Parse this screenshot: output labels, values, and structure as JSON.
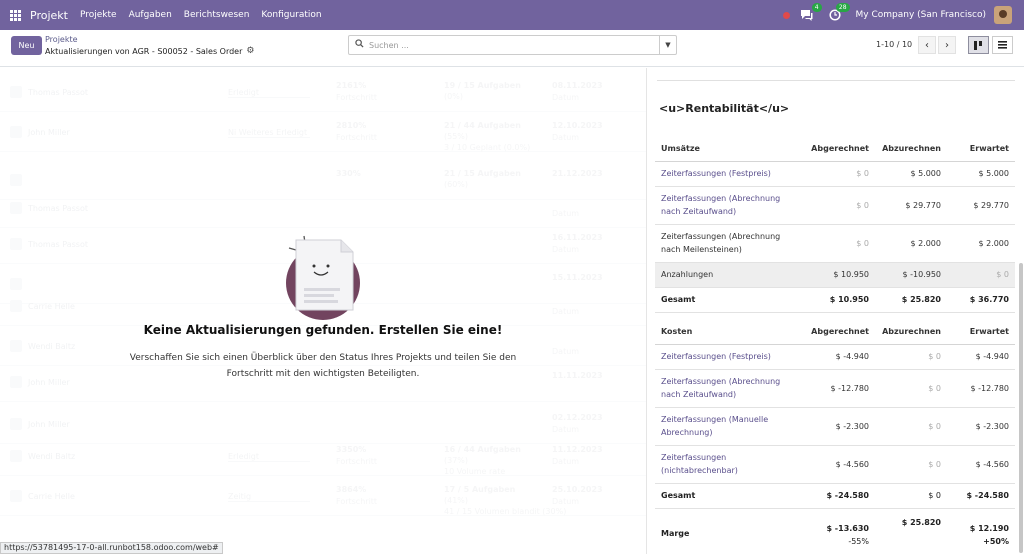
{
  "navbar": {
    "brand": "Projekt",
    "menu": [
      "Projekte",
      "Aufgaben",
      "Berichtswesen",
      "Konfiguration"
    ],
    "messages_count": "4",
    "activities_count": "28",
    "company": "My Company (San Francisco)",
    "colors": {
      "bar": "#71639e"
    }
  },
  "control_panel": {
    "new_label": "Neu",
    "breadcrumb_parent": "Projekte",
    "breadcrumb_current": "Aktualisierungen von AGR - S00052 - Sales Order",
    "search_placeholder": "Suchen ...",
    "pager": "1-10 / 10"
  },
  "background_rows": [
    {
      "name": "Thomas Passot",
      "status": "Erledigt",
      "progress": "2161%",
      "progress_sub": "Fortschritt",
      "tasks": "19 / 15 Aufgaben",
      "tasks_sub": "(0%)",
      "date": "08.11.2023",
      "date_sub": "Datum"
    },
    {
      "name": "John Miller",
      "status": "Ni Weiteres Erledigt",
      "progress": "2810%",
      "progress_sub": "Fortschritt",
      "tasks": "21 / 44 Aufgaben",
      "tasks_sub": "(55%)",
      "tasks_sub2": "3 / 10 Geplant (0.0%)",
      "date": "12.10.2023",
      "date_sub": "Datum"
    },
    {
      "name": "",
      "status": "",
      "progress": "330%",
      "progress_sub": "",
      "tasks": "21 / 15 Aufgaben",
      "tasks_sub": "(60%)",
      "tasks_sub2": "",
      "date": "21.12.2023",
      "date_sub": ""
    },
    {
      "name": "Thomas Passot",
      "status": "",
      "progress": "",
      "progress_sub": "",
      "tasks": "",
      "tasks_sub": "",
      "date": "",
      "date_sub": "Datum"
    },
    {
      "name": "Thomas Passot",
      "status": "",
      "progress": "",
      "progress_sub": "",
      "tasks": "",
      "tasks_sub": "",
      "date": "16.11.2023",
      "date_sub": "Datum"
    },
    {
      "name": "",
      "status": "",
      "progress": "",
      "progress_sub": "",
      "tasks": "",
      "tasks_sub": "",
      "date": "15.11.2023",
      "date_sub": ""
    },
    {
      "name": "Carrie Helle",
      "status": "",
      "progress": "",
      "progress_sub": "",
      "tasks": "",
      "tasks_sub": "",
      "date": "",
      "date_sub": "Datum"
    },
    {
      "name": "Wendi Baltz",
      "status": "",
      "progress": "",
      "progress_sub": "",
      "tasks": "",
      "tasks_sub": "",
      "date": "",
      "date_sub": "Datum"
    },
    {
      "name": "John Miller",
      "status": "",
      "progress": "",
      "progress_sub": "",
      "tasks": "",
      "tasks_sub": "",
      "date": "11.11.2023",
      "date_sub": ""
    },
    {
      "name": "John Miller",
      "status": "",
      "progress": "",
      "progress_sub": "",
      "tasks": "",
      "tasks_sub": "",
      "date": "02.12.2023",
      "date_sub": "Datum"
    },
    {
      "name": "Wendi Baltz",
      "status": "Erledigt",
      "progress": "3350%",
      "progress_sub": "Fortschritt",
      "tasks": "16 / 44 Aufgaben",
      "tasks_sub": "(37%)",
      "tasks_sub2": "10 Volume rate",
      "date": "11.12.2023",
      "date_sub": "Datum"
    },
    {
      "name": "Carrie Helle",
      "status": "Zeitig",
      "progress": "3864%",
      "progress_sub": "Fortschritt",
      "tasks": "17 / 5 Aufgaben",
      "tasks_sub": "(41%)",
      "tasks_sub2": "41 / 15 Volumen blandit (30%)",
      "date": "25.10.2023",
      "date_sub": "Datum"
    }
  ],
  "empty_state": {
    "title": "Keine Aktualisierungen gefunden. Erstellen Sie eine!",
    "text": "Verschaffen Sie sich einen Überblick über den Status Ihres Projekts und teilen Sie den Fortschritt mit den wichtigsten Beteiligten."
  },
  "profitability": {
    "title": "<u>Rentabilität</u>",
    "revenue": {
      "headers": [
        "Umsätze",
        "Abgerechnet",
        "Abzurechnen",
        "Erwartet"
      ],
      "rows": [
        {
          "label": "Zeiterfassungen (Festpreis)",
          "invoiced": "$ 0",
          "to_invoice": "$ 5.000",
          "expected": "$ 5.000"
        },
        {
          "label": "Zeiterfassungen (Abrechnung nach Zeitaufwand)",
          "invoiced": "$ 0",
          "to_invoice": "$ 29.770",
          "expected": "$ 29.770"
        },
        {
          "label": "Zeiterfassungen (Abrechnung nach Meilensteinen)",
          "invoiced": "$ 0",
          "to_invoice": "$ 2.000",
          "expected": "$ 2.000"
        },
        {
          "label": "Anzahlungen",
          "invoiced": "$ 10.950",
          "to_invoice": "$ -10.950",
          "expected": "$ 0"
        }
      ],
      "total": {
        "label": "Gesamt",
        "invoiced": "$ 10.950",
        "to_invoice": "$ 25.820",
        "expected": "$ 36.770"
      }
    },
    "costs": {
      "headers": [
        "Kosten",
        "Abgerechnet",
        "Abzurechnen",
        "Erwartet"
      ],
      "rows": [
        {
          "label": "Zeiterfassungen (Festpreis)",
          "invoiced": "$ -4.940",
          "to_invoice": "$ 0",
          "expected": "$ -4.940"
        },
        {
          "label": "Zeiterfassungen (Abrechnung nach Zeitaufwand)",
          "invoiced": "$ -12.780",
          "to_invoice": "$ 0",
          "expected": "$ -12.780"
        },
        {
          "label": "Zeiterfassungen (Manuelle Abrechnung)",
          "invoiced": "$ -2.300",
          "to_invoice": "$ 0",
          "expected": "$ -2.300"
        },
        {
          "label": "Zeiterfassungen (nichtabrechenbar)",
          "invoiced": "$ -4.560",
          "to_invoice": "$ 0",
          "expected": "$ -4.560"
        }
      ],
      "total": {
        "label": "Gesamt",
        "invoiced": "$ -24.580",
        "to_invoice": "$ 0",
        "expected": "$ -24.580"
      }
    },
    "margin": {
      "label": "Marge",
      "invoiced": "$ -13.630",
      "invoiced_pct": "-55%",
      "to_invoice": "$ 25.820",
      "expected": "$ 12.190",
      "expected_pct": "+50%"
    }
  },
  "statusbar": {
    "url": "https://53781495-17-0-all.runbot158.odoo.com/web#"
  }
}
